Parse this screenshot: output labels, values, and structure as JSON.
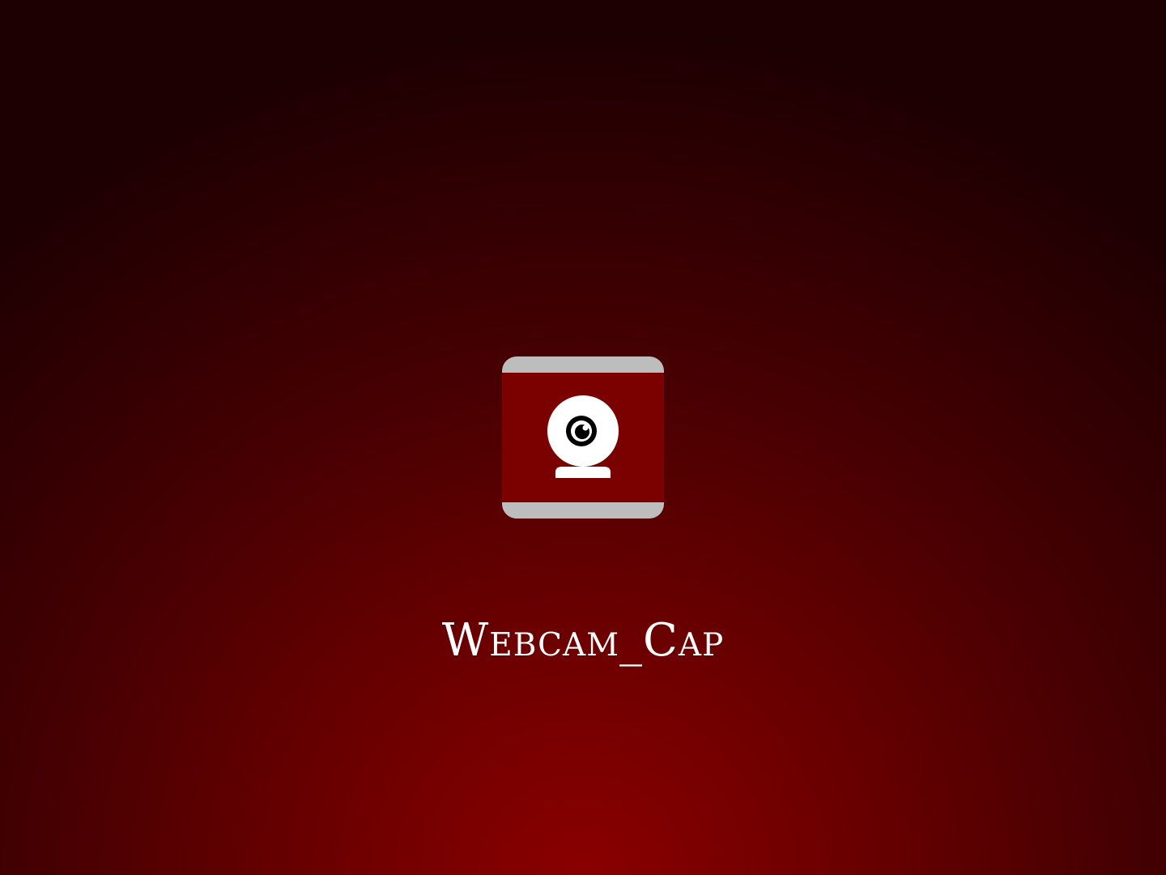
{
  "app": {
    "title": "Webcam_Cap",
    "icon": "webcam-icon"
  },
  "colors": {
    "background_center": "#8a0000",
    "background_edge": "#1c0002",
    "icon_fill": "#7b0000",
    "icon_band": "#bdbdbd",
    "title_text": "#ffffff"
  }
}
